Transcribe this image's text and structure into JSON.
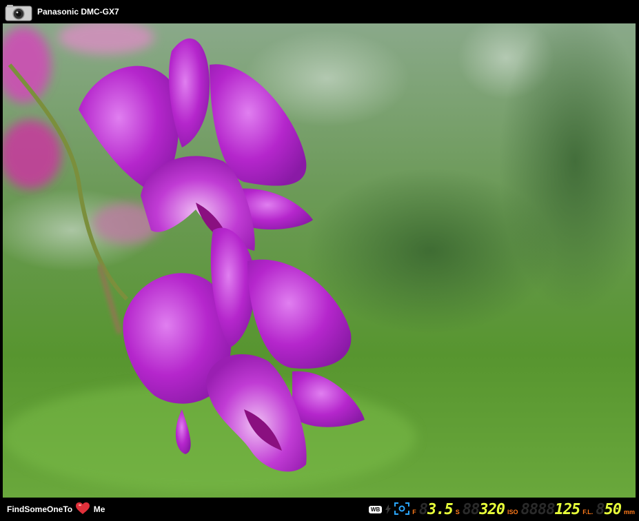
{
  "header": {
    "camera_icon": "camera-icon",
    "camera_model": "Panasonic DMC-GX7"
  },
  "photo": {
    "subject": "purple orchid flowers on green bokeh background",
    "colors": {
      "petal": "#b21fc8",
      "petal_light": "#e08af0",
      "background": "#5e9a3e"
    }
  },
  "footer": {
    "brand_left": "FindSomeOneTo",
    "brand_right": "Me",
    "heart_icon": "heart-icon",
    "wb_badge": "WB",
    "flash_icon": "flash-icon",
    "metering_icon": "metering-icon",
    "aperture_label": "F",
    "aperture_value": "3.5",
    "shutter_label": "S",
    "shutter_value": "320",
    "iso_label": "ISO",
    "iso_value": "125",
    "focal_label": "F.L.",
    "focal_value": "50",
    "focal_unit": "mm"
  }
}
